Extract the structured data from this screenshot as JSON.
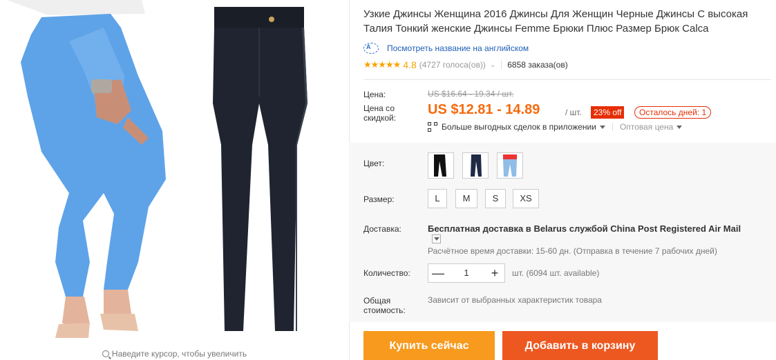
{
  "gallery": {
    "zoom_hint": "Наведите курсор, чтобы увеличить"
  },
  "product": {
    "title": "Узкие Джинсы Женщина 2016 Джинсы Для Женщин Черные Джинсы С высокая Талия Тонкий женские Джинсы Femme Брюки Плюс Размер Брюк Calca",
    "translate_link": "Посмотреть название на английском",
    "stars": "★★★★★",
    "rating": "4.8",
    "votes": "(4727 голоса(ов))",
    "orders": "6858 заказа(ов)"
  },
  "price": {
    "label": "Цена:",
    "old": "US $16.64 - 19.34 / шт.",
    "discount_label": "Цена со скидкой:",
    "new": "US $12.81 - 14.89",
    "per_unit": "/ шт.",
    "discount": "23% off",
    "days_left": "Осталось дней: 1",
    "app_deals": "Больше выгодных сделок в приложении",
    "wholesale": "Оптовая цена"
  },
  "options": {
    "color_label": "Цвет:",
    "colors": [
      "black-high-waist",
      "navy-skinny",
      "light-blue-jeans"
    ],
    "size_label": "Размер:",
    "sizes": [
      "L",
      "M",
      "S",
      "XS"
    ],
    "shipping_label": "Доставка:",
    "shipping_free": "Бесплатная доставка в",
    "shipping_country": "Belarus",
    "shipping_via": "службой",
    "shipping_service": "China Post Registered Air Mail",
    "shipping_estimate": "Расчётное время доставки: 15-60 дн. (Отправка в течение 7 рабочих дней)",
    "quantity_label": "Количество:",
    "quantity_minus": "—",
    "quantity": "1",
    "quantity_plus": "+",
    "quantity_available": "шт. (6094 шт. available)",
    "total_label": "Общая стоимость:",
    "total_text": "Зависит от выбранных характеристик товара"
  },
  "actions": {
    "buy_now": "Купить сейчас",
    "add_to_cart": "Добавить в корзину"
  },
  "colors": {
    "accent_orange": "#f56a0d",
    "buy_button": "#f79a1e",
    "cart_button": "#ed5821",
    "discount_red": "#e62e04",
    "star": "#f7a400",
    "link_blue": "#1f5fb8"
  }
}
